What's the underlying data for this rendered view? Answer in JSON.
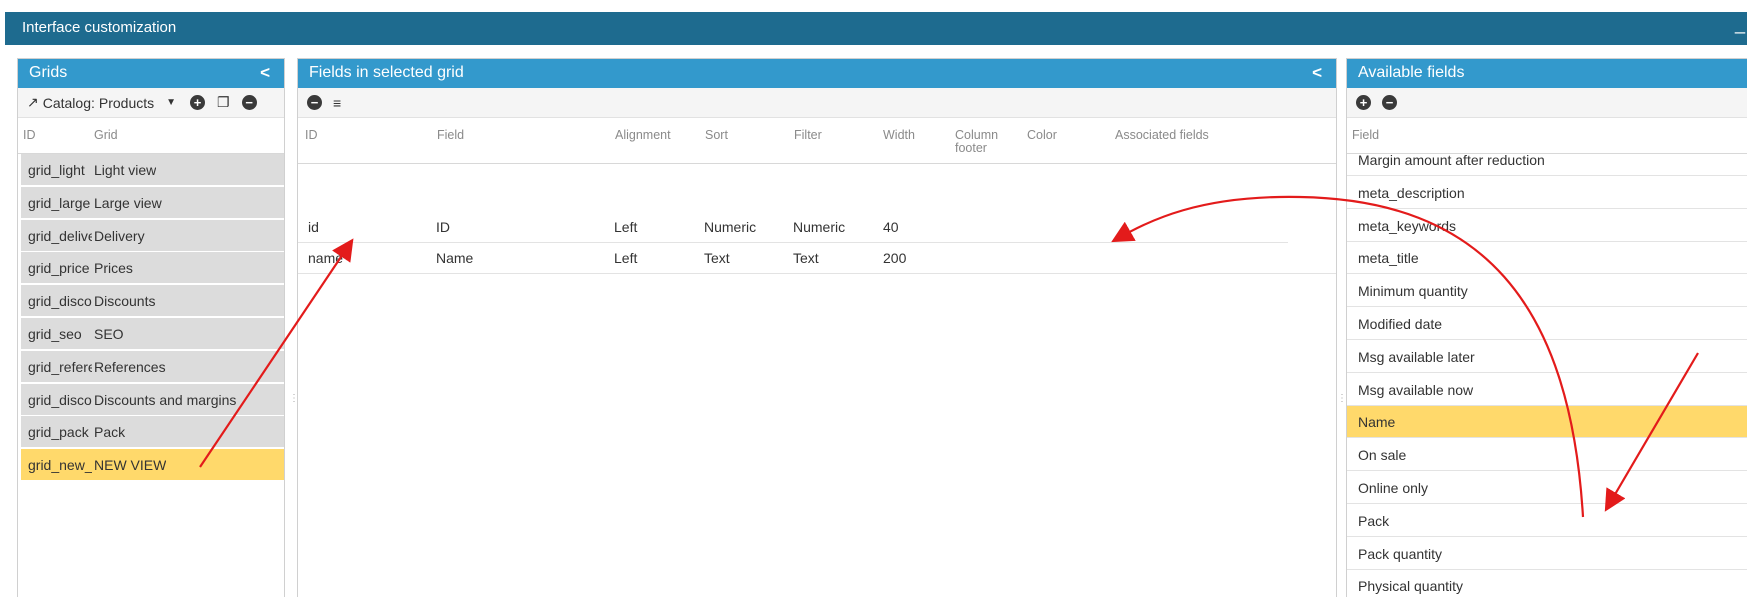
{
  "window": {
    "title": "Interface customization",
    "minimize_label": "_"
  },
  "grids_panel": {
    "title": "Grids",
    "collapse_label": "<",
    "catalog_label": "Catalog:",
    "catalog_value": "Products",
    "columns": {
      "id": "ID",
      "grid": "Grid"
    },
    "rows": [
      {
        "id": "grid_light",
        "grid": "Light view"
      },
      {
        "id": "grid_large",
        "grid": "Large view"
      },
      {
        "id": "grid_delive",
        "grid": "Delivery"
      },
      {
        "id": "grid_price",
        "grid": "Prices"
      },
      {
        "id": "grid_discou",
        "grid": "Discounts"
      },
      {
        "id": "grid_seo",
        "grid": "SEO"
      },
      {
        "id": "grid_refere",
        "grid": "References"
      },
      {
        "id": "grid_discou",
        "grid": "Discounts and margins"
      },
      {
        "id": "grid_pack",
        "grid": "Pack"
      },
      {
        "id": "grid_new_v",
        "grid": "NEW VIEW"
      }
    ],
    "selected_index": 9
  },
  "fields_panel": {
    "title": "Fields in selected grid",
    "collapse_label": "<",
    "columns": {
      "id": "ID",
      "field": "Field",
      "alignment": "Alignment",
      "sort": "Sort",
      "filter": "Filter",
      "width": "Width",
      "column_footer_1": "Column",
      "column_footer_2": "footer",
      "color": "Color",
      "associated": "Associated fields"
    },
    "rows": [
      {
        "id": "id",
        "field": "ID",
        "alignment": "Left",
        "sort": "Numeric",
        "filter": "Numeric",
        "width": "40"
      },
      {
        "id": "name",
        "field": "Name",
        "alignment": "Left",
        "sort": "Text",
        "filter": "Text",
        "width": "200"
      }
    ]
  },
  "available_panel": {
    "title": "Available fields",
    "column": "Field",
    "rows": [
      "Margin amount after reduction",
      "meta_description",
      "meta_keywords",
      "meta_title",
      "Minimum quantity",
      "Modified date",
      "Msg available later",
      "Msg available now",
      "Name",
      "On sale",
      "Online only",
      "Pack",
      "Pack quantity",
      "Physical quantity"
    ],
    "selected_index": 8
  },
  "colors": {
    "title_bar": "#1e6b8f",
    "panel_header": "#3399cc",
    "selection": "#ffd96b",
    "annotation_arrow": "#e31b1b"
  }
}
